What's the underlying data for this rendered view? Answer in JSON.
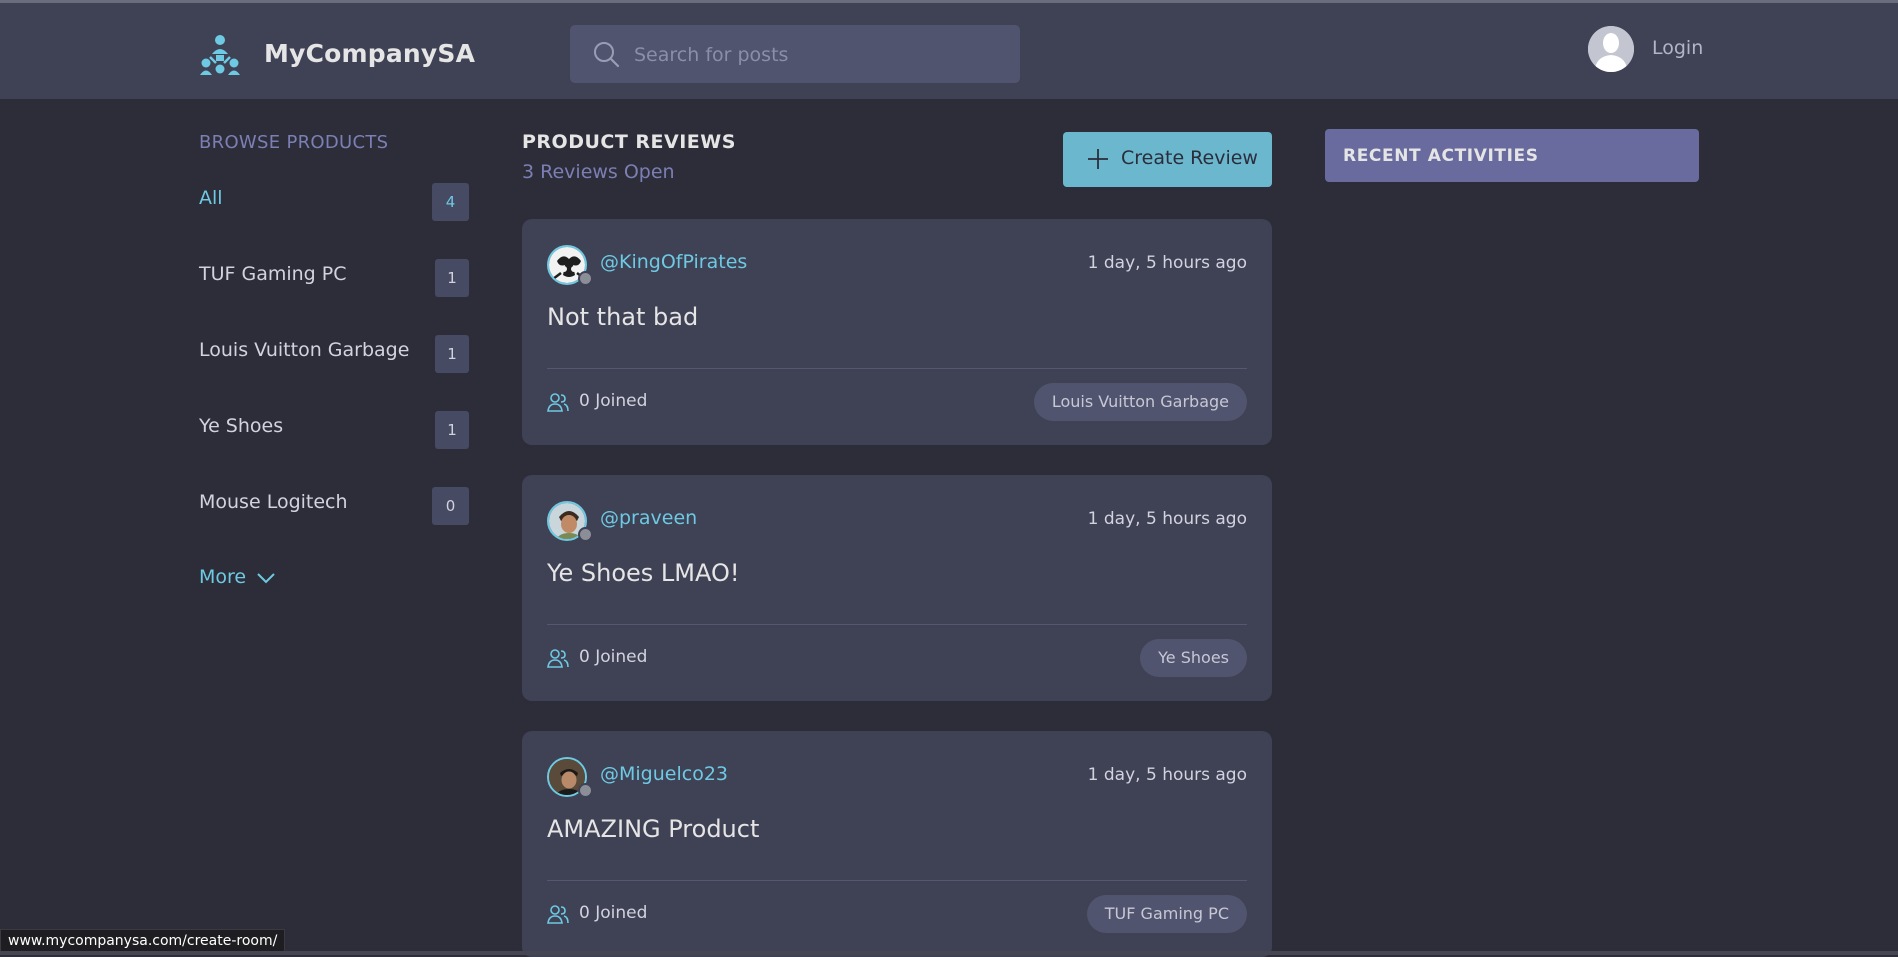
{
  "header": {
    "brand": "MyCompanySA",
    "search_placeholder": "Search for posts",
    "login_label": "Login"
  },
  "sidebar": {
    "title": "BROWSE PRODUCTS",
    "topics": [
      {
        "label": "All",
        "count": "4",
        "active": true
      },
      {
        "label": "TUF Gaming PC",
        "count": "1"
      },
      {
        "label": "Louis Vuitton Garbage",
        "count": "1"
      },
      {
        "label": "Ye Shoes",
        "count": "1"
      },
      {
        "label": "Mouse Logitech",
        "count": "0"
      }
    ],
    "more_label": "More"
  },
  "feed": {
    "title": "PRODUCT REVIEWS",
    "subtitle": "3 Reviews Open",
    "create_label": "Create Review",
    "reviews": [
      {
        "user": "@KingOfPirates",
        "time": "1 day, 5 hours ago",
        "title": "Not that bad",
        "joined": "0 Joined",
        "topic": "Louis Vuitton Garbage"
      },
      {
        "user": "@praveen",
        "time": "1 day, 5 hours ago",
        "title": "Ye Shoes LMAO!",
        "joined": "0 Joined",
        "topic": "Ye Shoes"
      },
      {
        "user": "@Miguelco23",
        "time": "1 day, 5 hours ago",
        "title": "AMAZING Product",
        "joined": "0 Joined",
        "topic": "TUF Gaming PC"
      }
    ]
  },
  "activity": {
    "title": "RECENT ACTIVITIES"
  },
  "statusbar": {
    "url": "www.mycompanysa.com/create-room/"
  },
  "colors": {
    "page_bg": "#2d2d39",
    "header_bg": "#3f4155",
    "card_bg": "#3f4155",
    "accent": "#6ec9e2",
    "button_bg": "#6ab7ce",
    "activity_bg": "#696b9e",
    "muted_purple": "#7b7fb3"
  }
}
